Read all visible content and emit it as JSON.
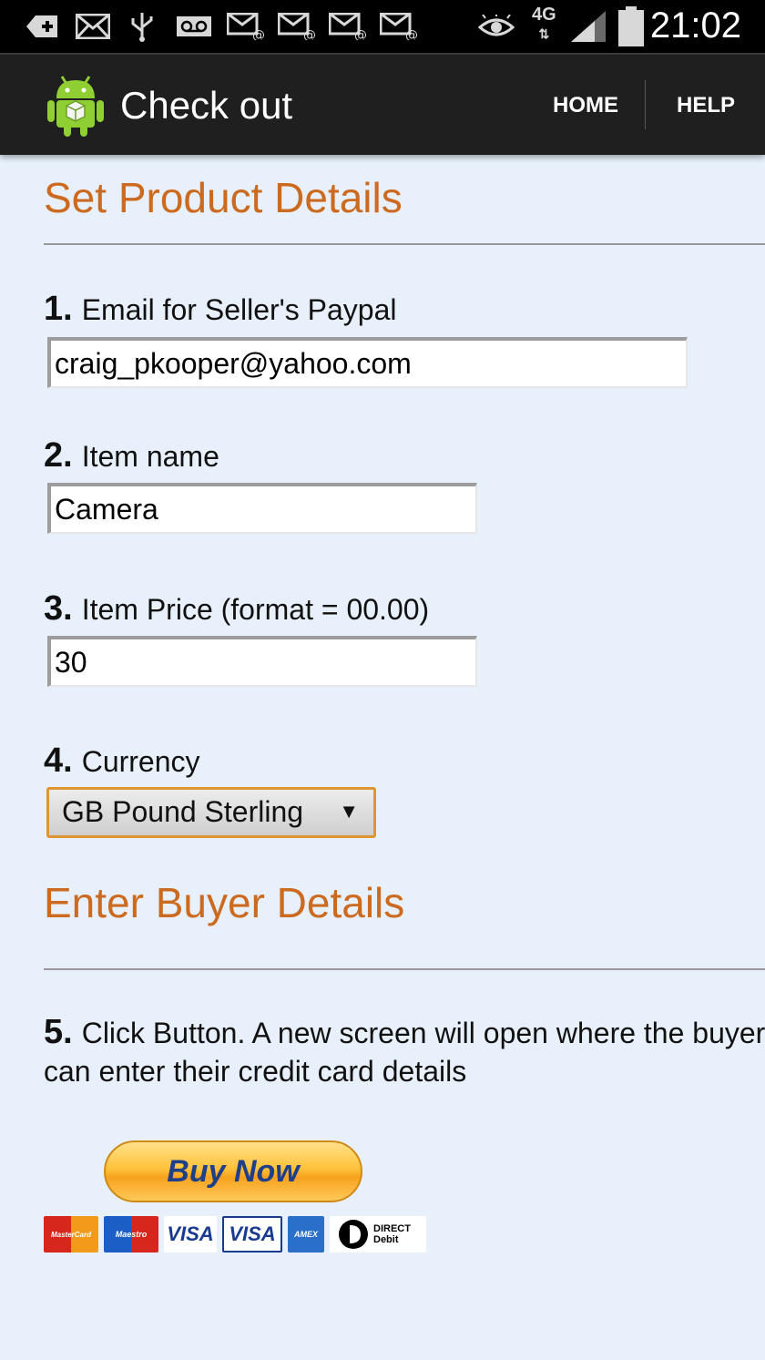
{
  "status_bar": {
    "time": "21:02",
    "network": "4G",
    "icons": [
      "add-notification-icon",
      "mail-icon",
      "usb-icon",
      "voicemail-icon",
      "mail-at-icon",
      "mail-at-icon",
      "mail-at-icon",
      "mail-at-icon",
      "eye-icon",
      "signal-icon",
      "battery-icon"
    ]
  },
  "action_bar": {
    "title": "Check out",
    "nav": {
      "home": "HOME",
      "help": "HELP"
    }
  },
  "product_section": {
    "heading": "Set Product Details",
    "steps": [
      {
        "number": "1.",
        "label": "Email for Seller's Paypal",
        "value": "craig_pkooper@yahoo.com"
      },
      {
        "number": "2.",
        "label": "Item name",
        "value": "Camera"
      },
      {
        "number": "3.",
        "label": "Item Price (format = 00.00)",
        "value": "30"
      },
      {
        "number": "4.",
        "label": "Currency",
        "value": "GB Pound Sterling"
      }
    ]
  },
  "buyer_section": {
    "heading": "Enter Buyer Details",
    "step5_number": "5.",
    "step5_line1": "Click Button. A new screen will open where the buyer",
    "step5_line2": "can enter their credit card details",
    "buy_button": "Buy Now",
    "cards": [
      "MasterCard",
      "Maestro",
      "VISA",
      "VISA",
      "AMEX",
      "DIRECT Debit"
    ]
  },
  "colors": {
    "heading": "#cc6a1f",
    "background": "#e8f1fb",
    "actionbar": "#1f1f1f"
  }
}
